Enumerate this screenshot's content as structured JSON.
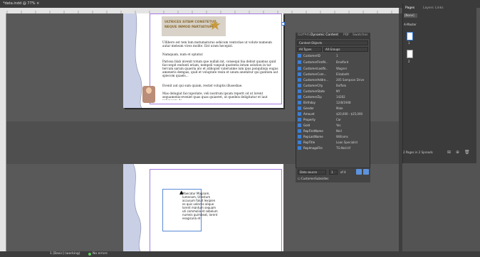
{
  "document": {
    "tab_title": "*data.indd @ 77% ×",
    "zoom": "77%"
  },
  "page1": {
    "banner_line1": "ULTRICES SITAM CONSTETUR,",
    "banner_line2": "NEQUE INMOD PARTIATIUM.",
    "paragraphs": [
      "Ullibero est tem lum metumaturus sehicum ventoriae ut volute numeum autar meleum vives molite. Ent uram hecepisl.",
      "Namquam, num et optatur.",
      "Pariosa blab invenit totum que nullab int, consequi bia debist quamus quid facconpit endunti eriam, nempeli vanpub quatenta intum solution in tar tercum sarum quaeria ato et atihopist vaterunme ium ipus ponqubiqu eugus ameneris dempas, quid et voluptate resin et unum anemitur qui gantism aut spiecom quaels...",
      "Evenit aut qui sum quiam, restist voluptis illuseshae.",
      "Mas delugiat faccuperiate, veli nostrum ipsum reperit od ut lorent sequamenis-eveniet quas quas quiaeret, ut quedeis deligitatur et laut volupuare de"
    ]
  },
  "page2": {
    "frame_text": "Maecatur Magnam, lumenam, Ullestum accusum faluit lexipien es quis volectis alique lorent mantum sequam uti commolia et sebelum numeis quimbeat, lorent esogiculia et"
  },
  "status_bar": {
    "page_field": "1",
    "style": "[Basic] (working)",
    "errors": "No errors"
  },
  "dynamic_content_panel": {
    "tabs": [
      "GLYPHS",
      "Dynamic Content",
      "PDF",
      "Swatches"
    ],
    "active_tab": "Dynamic Content",
    "content_objects_select": "Content Objects",
    "all_types": "All Types",
    "all_groups": "All Groups",
    "rows": [
      {
        "icon": "field-icon",
        "name": "CustomerID",
        "value": "1"
      },
      {
        "icon": "field-icon",
        "name": "CustomerFirstN...",
        "value": "Bradford"
      },
      {
        "icon": "field-icon",
        "name": "CustomerLastN...",
        "value": "Wagner"
      },
      {
        "icon": "field-icon",
        "name": "CustomerCom...",
        "value": "Elizabeth"
      },
      {
        "icon": "field-icon",
        "name": "CustomerAddre...",
        "value": "205 Sampson Drive"
      },
      {
        "icon": "field-icon",
        "name": "CustomerCity",
        "value": "Buffalo"
      },
      {
        "icon": "field-icon",
        "name": "CustomerState",
        "value": "NY"
      },
      {
        "icon": "field-icon",
        "name": "CustomerZip",
        "value": "14202"
      },
      {
        "icon": "field-icon",
        "name": "Birthday",
        "value": "12/8/1948"
      },
      {
        "icon": "field-icon",
        "name": "Gender",
        "value": "Male"
      },
      {
        "icon": "field-icon",
        "name": "Amount",
        "value": "$20,000 - $25,000"
      },
      {
        "icon": "field-icon",
        "name": "Property",
        "value": "Car"
      },
      {
        "icon": "field-icon",
        "name": "Gold",
        "value": "Yes"
      },
      {
        "icon": "field-icon",
        "name": "RepFirstName",
        "value": "Neil"
      },
      {
        "icon": "field-icon",
        "name": "RepLastName",
        "value": "Williams"
      },
      {
        "icon": "field-icon",
        "name": "RepTitle",
        "value": "Loan Specialist"
      },
      {
        "icon": "field-icon",
        "name": "RepImageFile",
        "value": "TG-Neil.tif"
      }
    ],
    "footer_select": "Data source",
    "footer_page": "1",
    "footer_of": "of 4",
    "footer_checkbox_label": "CustomerSubsidies"
  },
  "pages_panel": {
    "tabs": [
      "Pages",
      "Layers",
      "Links"
    ],
    "none_label": "[None]",
    "master_label": "A-Master",
    "page_numbers": [
      "1",
      "2"
    ],
    "footer_text": "2 Pages in 2 Spreads"
  },
  "colors": {
    "accent": "#3d7fd6",
    "margin_guide": "#a678e0",
    "pasteboard": "#595959"
  }
}
